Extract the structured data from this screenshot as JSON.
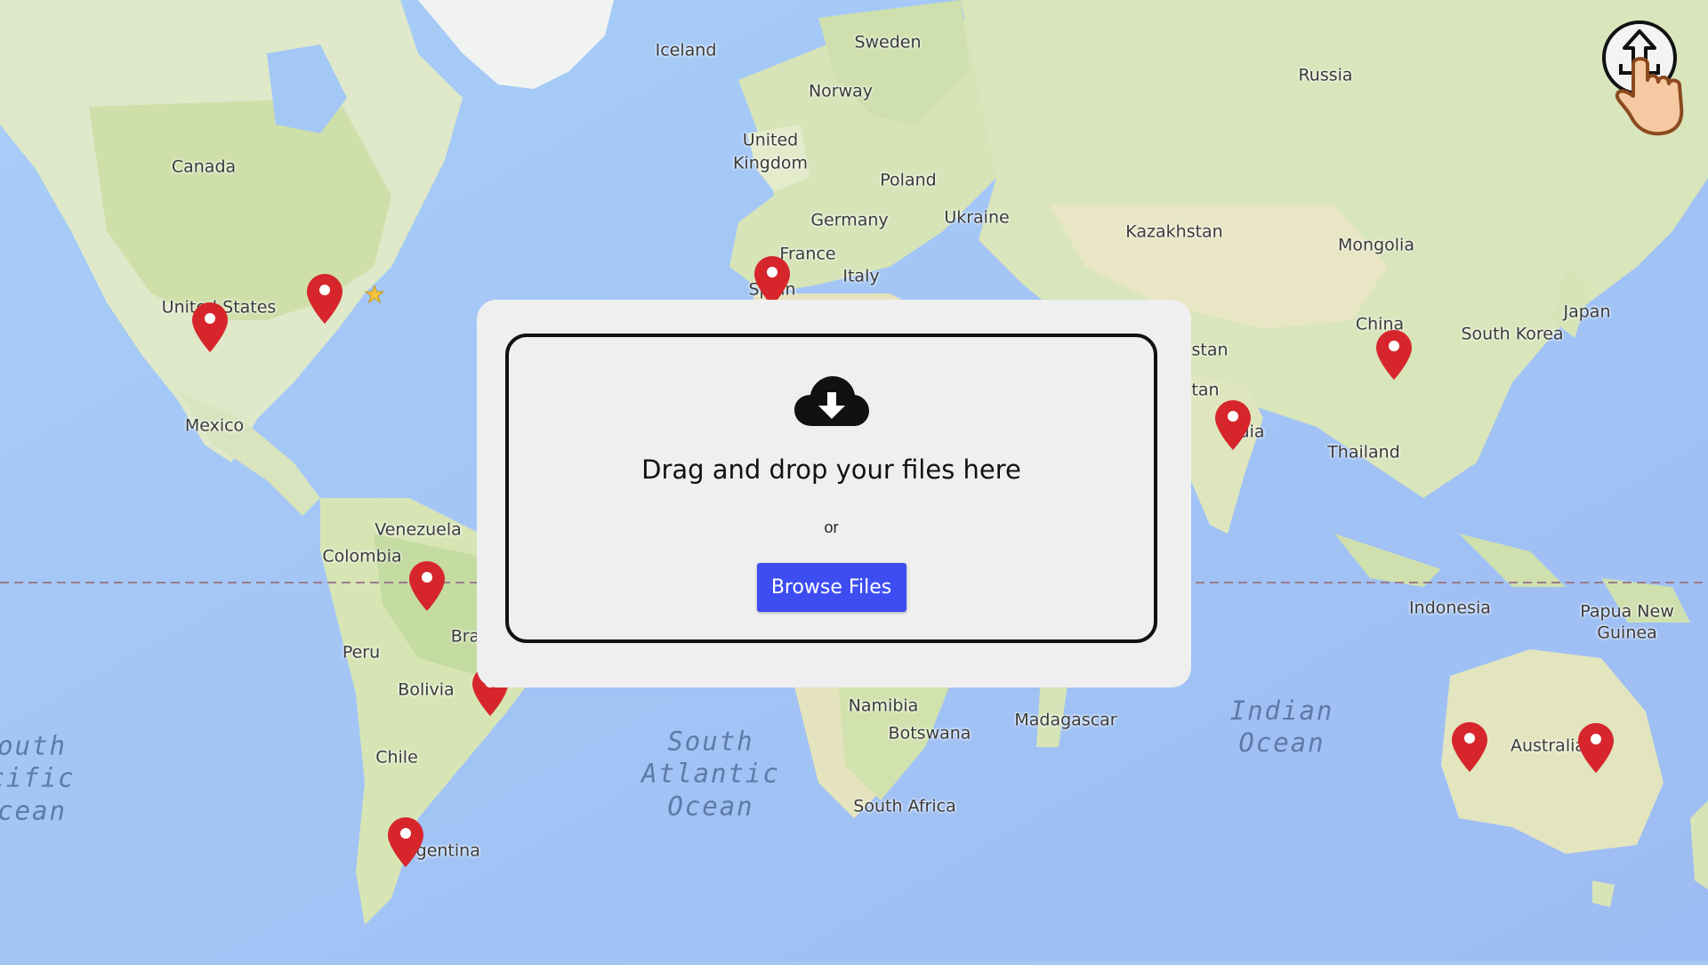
{
  "map": {
    "country_labels": {
      "iceland": "Iceland",
      "sweden": "Sweden",
      "norway": "Norway",
      "russia": "Russia",
      "united_kingdom_1": "United",
      "united_kingdom_2": "Kingdom",
      "poland": "Poland",
      "germany": "Germany",
      "ukraine": "Ukraine",
      "france": "France",
      "italy": "Italy",
      "spain": "Spain",
      "kazakhstan": "Kazakhstan",
      "mongolia": "Mongolia",
      "canada": "Canada",
      "united_states": "United States",
      "mexico": "Mexico",
      "china": "China",
      "south_korea": "South Korea",
      "japan": "Japan",
      "pakistan": "stan",
      "afghanistan": "tan",
      "india": "dia",
      "thailand": "Thailand",
      "venezuela": "Venezuela",
      "colombia": "Colombia",
      "brazil": "Bra",
      "peru": "Peru",
      "bolivia": "Bolivia",
      "chile": "Chile",
      "argentina": "rgentina",
      "indonesia": "Indonesia",
      "papua_1": "Papua New",
      "papua_2": "Guinea",
      "namibia": "Namibia",
      "botswana": "Botswana",
      "madagascar": "Madagascar",
      "south_africa": "South Africa",
      "australia": "Australia"
    },
    "ocean_labels": {
      "south_atlantic": "South\nAtlantic\nOcean",
      "indian": "Indian\nOcean",
      "south_pacific": "outh\ncific\ncean"
    },
    "marker_color": "#d6262c",
    "marker_count": 11
  },
  "upload_dialog": {
    "icon": "cloud-download-icon",
    "title": "Drag and drop your files here",
    "separator": "or",
    "browse_label": "Browse Files",
    "accent_color": "#3d4df2"
  },
  "corner_icon": "upload-touch-icon"
}
